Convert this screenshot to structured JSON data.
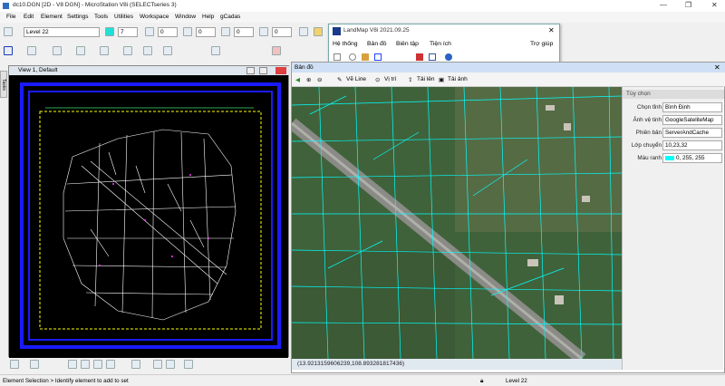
{
  "window": {
    "title": "dc10.DGN [2D - V8 DGN] - MicroStation V8i (SELECTseries 3)"
  },
  "menubar": [
    "File",
    "Edit",
    "Element",
    "Settings",
    "Tools",
    "Utilities",
    "Workspace",
    "Window",
    "Help",
    "gCadas"
  ],
  "toolbar": {
    "level": "Level 22",
    "color": "7",
    "style": "0",
    "weight": "0",
    "transparency": "0",
    "priority": "0"
  },
  "side_tab": "Tasks",
  "view": {
    "title": "View 1, Default"
  },
  "landmap": {
    "title": "LandMap V8i 2021.09.25",
    "menu": [
      "Hệ thống",
      "Bản đồ",
      "Biên tập",
      "Tiện ích"
    ],
    "help": "Trợ giúp"
  },
  "map_pane": {
    "title": "Bản đồ",
    "tools": {
      "draw_line": "Vẽ Line",
      "position": "Vị trí",
      "upload": "Tải lên",
      "photo": "Tải ảnh"
    },
    "coordinates": "(13.9213159606239,108.893281817436)"
  },
  "properties": {
    "header": "Tùy chọn",
    "rows": [
      {
        "label": "Chọn tỉnh",
        "value": "Bình Định"
      },
      {
        "label": "Ảnh vệ tinh",
        "value": "GoogleSateliteMap"
      },
      {
        "label": "Phiên bản",
        "value": "ServerAndCache"
      },
      {
        "label": "Lớp chuyển",
        "value": "10,23,32"
      },
      {
        "label": "Màu ranh",
        "value": "0, 255, 255"
      }
    ]
  },
  "status": {
    "message": "Element Selection > Identify element to add to set",
    "level": "Level 22"
  },
  "colors": {
    "boundary_color": "#00ffff",
    "view_border": "#1a1aff",
    "selection_box": "#ffff00"
  }
}
